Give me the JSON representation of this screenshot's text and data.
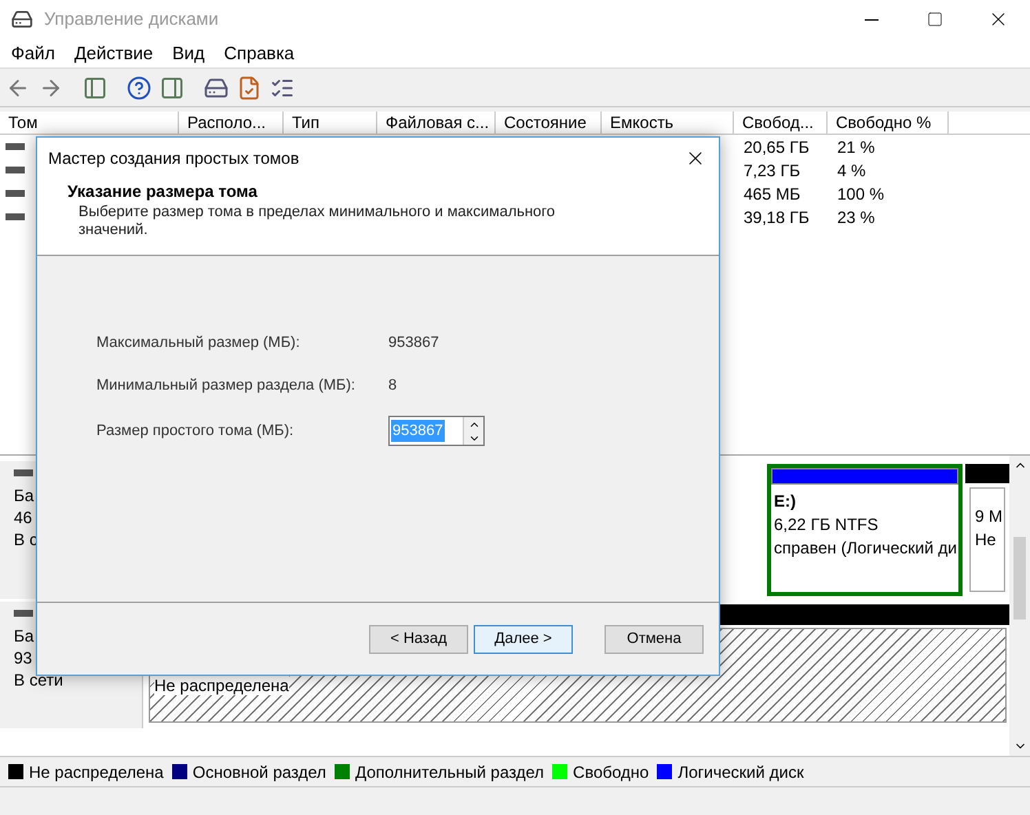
{
  "window": {
    "title": "Управление дисками"
  },
  "menu": [
    "Файл",
    "Действие",
    "Вид",
    "Справка"
  ],
  "volumes": {
    "columns": [
      "Том",
      "Располо...",
      "Тип",
      "Файловая с...",
      "Состояние",
      "Емкость",
      "Свобод...",
      "Свободно %"
    ],
    "rows": [
      {
        "free": "20,65 ГБ",
        "free_percent": "21 %"
      },
      {
        "free": "7,23 ГБ",
        "free_percent": "4 %"
      },
      {
        "free": "465 МБ",
        "free_percent": "100 %"
      },
      {
        "free": "39,18 ГБ",
        "free_percent": "23 %"
      }
    ]
  },
  "disks": [
    {
      "label_lines": [
        "Ба",
        "46",
        "В с"
      ],
      "partitions": [
        {
          "kind": "hidden"
        },
        {
          "kind": "logical",
          "lines": [
            "E:)",
            "6,22 ГБ NTFS",
            "справен (Логический ди"
          ]
        },
        {
          "kind": "other",
          "lines": [
            "9 М",
            "Не"
          ]
        }
      ]
    },
    {
      "label_lines": [
        "Ба",
        "93",
        "В сети"
      ],
      "partitions": [
        {
          "kind": "unallocated",
          "lines": [
            "Не распределена"
          ]
        }
      ]
    }
  ],
  "legend": [
    {
      "label": "Не распределена",
      "color": "#000000"
    },
    {
      "label": "Основной раздел",
      "color": "#000080"
    },
    {
      "label": "Дополнительный раздел",
      "color": "#008000"
    },
    {
      "label": "Свободно",
      "color": "#00ff00"
    },
    {
      "label": "Логический диск",
      "color": "#0000ff"
    }
  ],
  "dialog": {
    "title": "Мастер создания простых томов",
    "heading": "Указание размера тома",
    "subtitle": "Выберите размер тома в пределах минимального и максимального значений.",
    "info": [
      {
        "label": "Максимальный размер (МБ):",
        "value": "953867"
      },
      {
        "label": "Минимальный размер раздела (МБ):",
        "value": "8"
      }
    ],
    "size_field": {
      "label": "Размер простого тома (МБ):",
      "value": "953867",
      "text_selected": true
    },
    "buttons": [
      {
        "label": "< Назад",
        "default": false
      },
      {
        "label": "Далее >",
        "default": true
      },
      {
        "label": "Отмена",
        "default": false
      }
    ]
  }
}
